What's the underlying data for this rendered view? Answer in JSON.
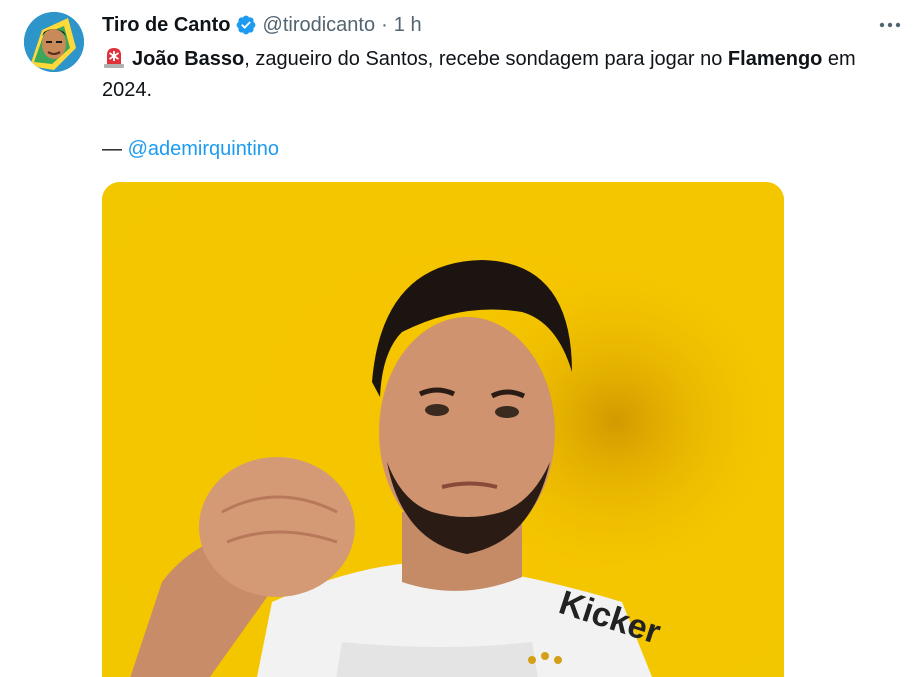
{
  "tweet": {
    "author": {
      "name": "Tiro de Canto",
      "handle": "@tirodicanto",
      "separator": "·",
      "time": "1 h"
    },
    "icons": {
      "verified": "verified-badge-icon",
      "more": "more-options-icon",
      "siren": "rotating-light-emoji-icon"
    },
    "text": {
      "part1_bold": "João Basso",
      "part2": ", zagueiro do Santos, recebe sondagem para jogar no ",
      "part3_bold": "Flamengo",
      "part4": " em 2024."
    },
    "credit": {
      "dash": "— ",
      "mention": "@ademirquintino"
    },
    "jersey_text": "Kicker",
    "colors": {
      "accent": "#1d9bf0",
      "verified": "#1d9bf0",
      "background_media": "#f7c600",
      "secondary_text": "#536471"
    }
  }
}
